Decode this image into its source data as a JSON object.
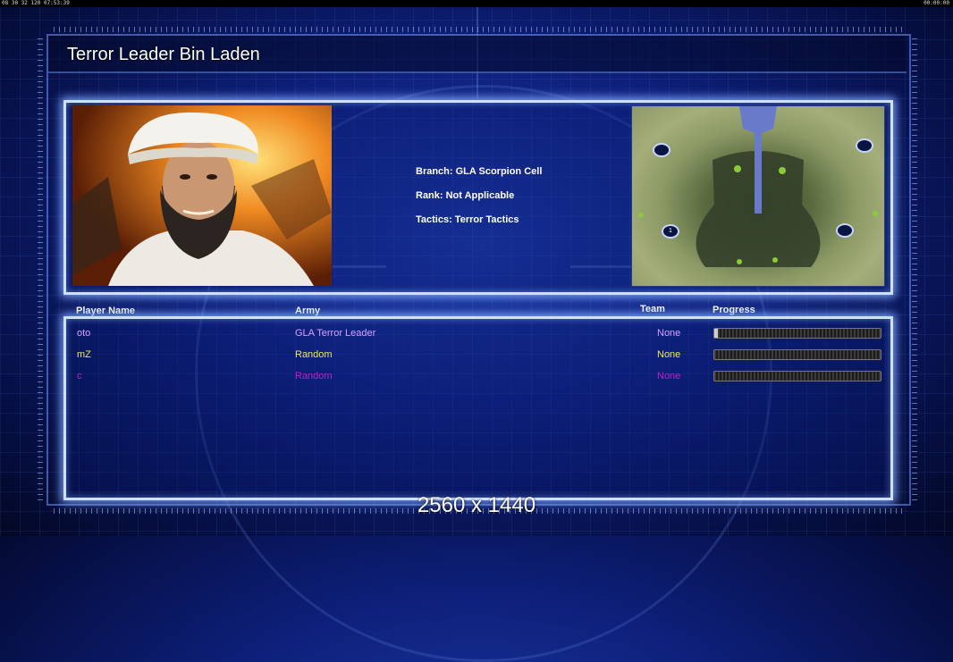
{
  "top_strip": {
    "left_text": "08 30 32 120 07:53:39",
    "right_text": "00:00:00"
  },
  "title": "Terror Leader Bin Laden",
  "general": {
    "branch": "Branch: GLA Scorpion Cell",
    "rank": "Rank: Not Applicable",
    "tactics": "Tactics: Terror Tactics"
  },
  "map": {
    "start_marker_label": "1"
  },
  "players_table": {
    "headers": {
      "player_name": "Player Name",
      "army": "Army",
      "team": "Team",
      "progress": "Progress"
    },
    "rows": [
      {
        "name": "oto",
        "army": "GLA Terror Leader",
        "team": "None",
        "color": "#d8a0ff",
        "progress": 0.02
      },
      {
        "name": "mZ",
        "army": "Random",
        "team": "None",
        "color": "#f0e84a",
        "progress": 0.0
      },
      {
        "name": "c",
        "army": "Random",
        "team": "None",
        "color": "#c020c8",
        "progress": 0.0
      }
    ]
  },
  "resolution_caption": "2560 x 1440"
}
